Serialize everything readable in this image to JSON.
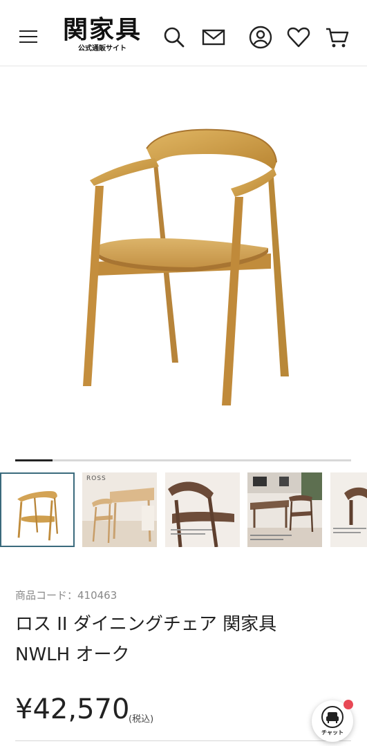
{
  "header": {
    "logo_main": "関家具",
    "logo_sub": "公式通販サイト",
    "icons": [
      "menu-icon",
      "search-icon",
      "mail-icon",
      "account-icon",
      "heart-icon",
      "cart-icon"
    ]
  },
  "gallery": {
    "slide_index": 1,
    "slide_count": 9,
    "thumbnails": [
      {
        "name": "chair-front",
        "active": true,
        "caption": ""
      },
      {
        "name": "ross-lifestyle",
        "active": false,
        "caption": "ROSS"
      },
      {
        "name": "armrest-detail",
        "active": false,
        "caption": ""
      },
      {
        "name": "room-scene",
        "active": false,
        "caption": ""
      },
      {
        "name": "backrest-detail",
        "active": false,
        "caption": ""
      }
    ]
  },
  "product": {
    "code_label": "商品コード：410463",
    "title_line1": "ロス II ダイニングチェア 関家具",
    "title_line2": "NWLH オーク",
    "price": "¥42,570",
    "tax_note": "(税込)"
  },
  "chat": {
    "label": "チャット",
    "badge_color": "#e84855"
  },
  "colors": {
    "accent": "#3a6a7c",
    "text": "#222222",
    "muted": "#888888",
    "wood": "#c8963e"
  }
}
